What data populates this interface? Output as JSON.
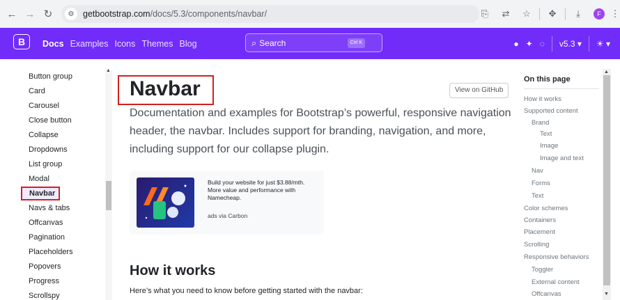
{
  "browser": {
    "url_domain": "getbootstrap.com",
    "url_path": "/docs/5.3/components/navbar/",
    "profile_initial": "F"
  },
  "navbar": {
    "brand_letter": "B",
    "links": [
      "Docs",
      "Examples",
      "Icons",
      "Themes",
      "Blog"
    ],
    "search_placeholder": "Search",
    "search_shortcut": "Ctrl K",
    "version": "v5.3"
  },
  "sidebar": {
    "items": [
      "Button group",
      "Card",
      "Carousel",
      "Close button",
      "Collapse",
      "Dropdowns",
      "List group",
      "Modal",
      "Navbar",
      "Navs & tabs",
      "Offcanvas",
      "Pagination",
      "Placeholders",
      "Popovers",
      "Progress",
      "Scrollspy"
    ],
    "active": "Navbar"
  },
  "main": {
    "title": "Navbar",
    "view_on_github": "View on GitHub",
    "lead": "Documentation and examples for Bootstrap’s powerful, responsive navigation header, the navbar. Includes support for branding, navigation, and more, including support for our collapse plugin.",
    "ad_text": "Build your website for just $3.88/mth. More value and performance with Namecheap.",
    "ad_via": "ads via Carbon",
    "section_title": "How it works",
    "section_intro": "Here’s what you need to know before getting started with the navbar:"
  },
  "toc": {
    "title": "On this page",
    "items": [
      {
        "label": "How it works",
        "level": 0
      },
      {
        "label": "Supported content",
        "level": 0
      },
      {
        "label": "Brand",
        "level": 1
      },
      {
        "label": "Text",
        "level": 2
      },
      {
        "label": "Image",
        "level": 2
      },
      {
        "label": "Image and text",
        "level": 2
      },
      {
        "label": "Nav",
        "level": 1
      },
      {
        "label": "Forms",
        "level": 1
      },
      {
        "label": "Text",
        "level": 1
      },
      {
        "label": "Color schemes",
        "level": 0
      },
      {
        "label": "Containers",
        "level": 0
      },
      {
        "label": "Placement",
        "level": 0
      },
      {
        "label": "Scrolling",
        "level": 0
      },
      {
        "label": "Responsive behaviors",
        "level": 0
      },
      {
        "label": "Toggler",
        "level": 1
      },
      {
        "label": "External content",
        "level": 1
      },
      {
        "label": "Offcanvas",
        "level": 1
      }
    ]
  },
  "colors": {
    "brand_purple": "#712cf9",
    "highlight_red": "#d21f1f"
  }
}
